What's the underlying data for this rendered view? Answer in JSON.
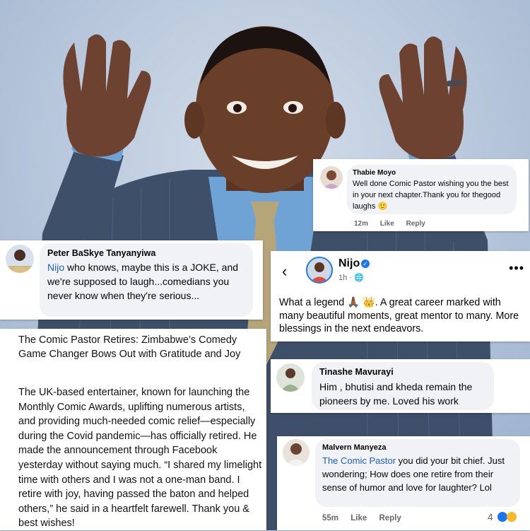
{
  "colors": {
    "background_sky": "#b7c6dc",
    "suit": "#3e4f6a",
    "shirt": "#6fa3d6",
    "tie": "#b7a57a",
    "skin": "#6a3f2a",
    "mention": "#1d5fbf",
    "verified_badge": "#1877f2",
    "bubble": "#f0f2f5",
    "meta_gray": "#65676b"
  },
  "comments": {
    "thabie": {
      "name": "Thabie Moyo",
      "text": "Well done Comic Pastor wishing you the best in your next chapter.Thank you for thegood laughs 🙂",
      "time": "12m",
      "like": "Like",
      "reply": "Reply"
    },
    "peter": {
      "name": "Peter BaSkye Tanyanyiwa",
      "mention": "Nijo",
      "text": " who knows, maybe this is a JOKE, and we're supposed to laugh...comedians you never know when they're serious..."
    },
    "tinashe": {
      "name": "Tinashe Mavurayi",
      "text": "Him , bhutisi and kheda remain the pioneers by me. Loved his work"
    },
    "malvern": {
      "name": "Malvern Manyeza",
      "mention": "The Comic Pastor",
      "text": " you did your bit chief. Just wondering; How does one retire from their sense of humor and love for laughter? Lol",
      "time": "55m",
      "like": "Like",
      "reply": "Reply",
      "reaction_count": "4"
    }
  },
  "post": {
    "back_icon": "chevron-left-icon",
    "author": "Nijo",
    "verified_icon": "verified-badge-icon",
    "time": "1h · 🌐",
    "more_label": "•••",
    "text": "What a legend 🙏🏾 👑. A great career marked with many beautiful moments, great mentor to many. More blessings in the next endeavors."
  },
  "article": {
    "title": "The Comic Pastor Retires: Zimbabwe’s Comedy Game Changer Bows Out with Gratitude and Joy",
    "body": "The UK-based entertainer, known for launching the Monthly Comic Awards, uplifting numerous artists, and providing much-needed comic relief—especially during the Covid pandemic—has officially retired. He made the announcement through Facebook yesterday without saying much. “I shared my limelight time with others and I was not a one-man band. I retire with joy, having passed the baton and helped others,” he said in a heartfelt farewell. Thank you & best wishes!"
  }
}
